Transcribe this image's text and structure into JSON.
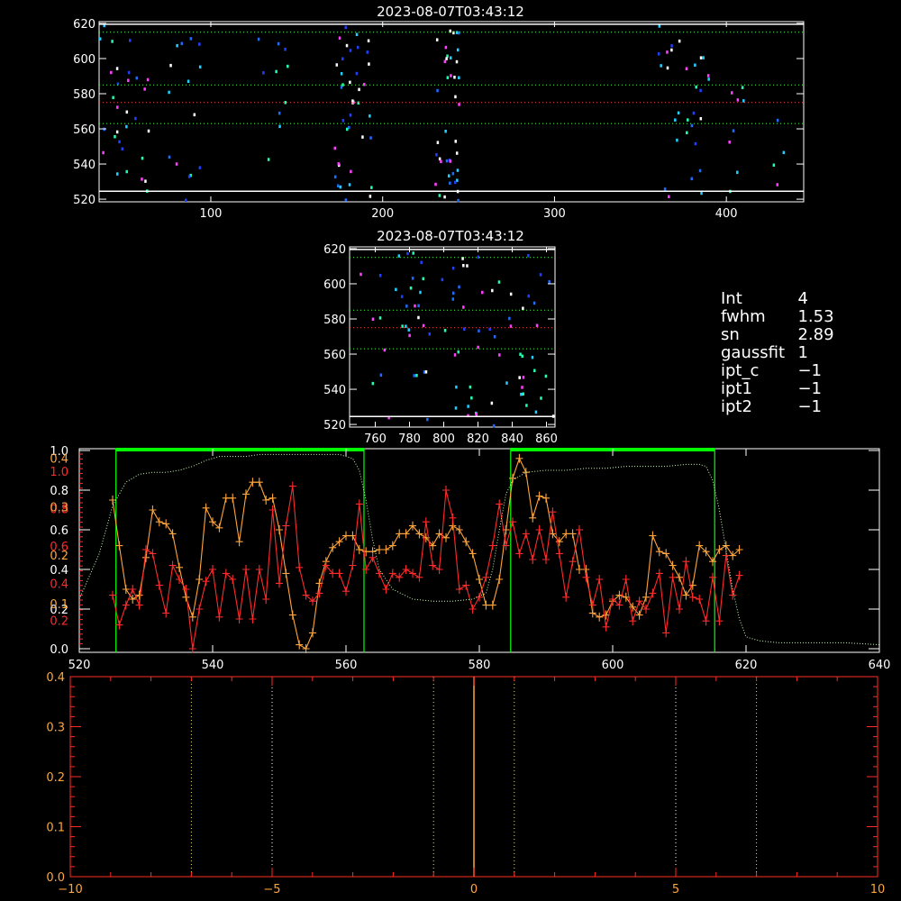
{
  "colors": {
    "bg": "#000000",
    "axis": "#ffffff",
    "orange": "#ffa53a",
    "red": "#ff2a2a",
    "green": "#00ff00",
    "lightgreen": "#c8ffb0",
    "speckle_blue": "#1e6bff",
    "speckle_cyan": "#20d0ff",
    "speckle_teal": "#20ffb0",
    "speckle_magenta": "#ff40ff",
    "dotted_green": "#40ff40",
    "dotted_red": "#ff4040"
  },
  "top_image": {
    "title": "2023-08-07T03:43:12",
    "xticks": [
      "100",
      "200",
      "300",
      "400"
    ],
    "yticks": [
      "520",
      "540",
      "560",
      "580",
      "600",
      "620"
    ]
  },
  "mid_image": {
    "title": "2023-08-07T03:43:12",
    "xticks": [
      "760",
      "780",
      "800",
      "820",
      "840",
      "860"
    ],
    "yticks": [
      "520",
      "540",
      "560",
      "580",
      "600",
      "620"
    ]
  },
  "info": [
    {
      "key": "Int",
      "value": "4"
    },
    {
      "key": "fwhm",
      "value": "1.53"
    },
    {
      "key": "sn",
      "value": "2.89"
    },
    {
      "key": "gaussfit",
      "value": "1"
    },
    {
      "key": "ipt_c",
      "value": "−1"
    },
    {
      "key": "ipt1",
      "value": "−1"
    },
    {
      "key": "ipt2",
      "value": "−1"
    }
  ],
  "chart_data": [
    {
      "type": "line",
      "xlim": [
        520,
        640
      ],
      "xticks": [
        "520",
        "540",
        "560",
        "580",
        "600",
        "620",
        "640"
      ],
      "left_ticks_white": [
        "0.0",
        "0.2",
        "0.4",
        "0.6",
        "0.8",
        "1.0"
      ],
      "left_ticks_red": [
        "0.2",
        "0.4",
        "0.6",
        "0.8",
        "1.0"
      ],
      "left_ticks_yellow": [
        "0.1",
        "0.2",
        "0.3",
        "0.4"
      ],
      "green_boxes": [
        [
          525.5,
          562.7
        ],
        [
          584.7,
          615.3
        ]
      ],
      "series": [
        {
          "color": "orange",
          "x": [
            525,
            526,
            527,
            528,
            529,
            530,
            531,
            532,
            533,
            534,
            535,
            536,
            537,
            538,
            539,
            540,
            541,
            542,
            543,
            544,
            545,
            546,
            547,
            548,
            549,
            550,
            551,
            552,
            553,
            554,
            555,
            556,
            557,
            558,
            559,
            560,
            561,
            562,
            563,
            564,
            565,
            566,
            567,
            568,
            569,
            570,
            571,
            572,
            573,
            574,
            575,
            576,
            577,
            578,
            579,
            580,
            581,
            582,
            583,
            584,
            585,
            586,
            587,
            588,
            589,
            590,
            591,
            592,
            593,
            594,
            595,
            596,
            597,
            598,
            599,
            600,
            601,
            602,
            603,
            604,
            605,
            606,
            607,
            608,
            609,
            610,
            611,
            612,
            613,
            614,
            615,
            616,
            617,
            618,
            619
          ],
          "y": [
            0.75,
            0.52,
            0.3,
            0.25,
            0.27,
            0.46,
            0.7,
            0.64,
            0.63,
            0.58,
            0.41,
            0.26,
            0.16,
            0.35,
            0.71,
            0.64,
            0.61,
            0.76,
            0.76,
            0.54,
            0.78,
            0.84,
            0.84,
            0.75,
            0.76,
            0.6,
            0.38,
            0.17,
            0.02,
            0.0,
            0.08,
            0.33,
            0.44,
            0.51,
            0.54,
            0.57,
            0.57,
            0.5,
            0.49,
            0.49,
            0.5,
            0.5,
            0.52,
            0.58,
            0.58,
            0.62,
            0.58,
            0.56,
            0.52,
            0.58,
            0.56,
            0.62,
            0.6,
            0.54,
            0.48,
            0.35,
            0.22,
            0.22,
            0.35,
            0.6,
            0.86,
            0.96,
            0.89,
            0.66,
            0.77,
            0.76,
            0.58,
            0.54,
            0.58,
            0.58,
            0.4,
            0.4,
            0.18,
            0.16,
            0.17,
            0.24,
            0.27,
            0.26,
            0.21,
            0.17,
            0.26,
            0.57,
            0.49,
            0.48,
            0.42,
            0.36,
            0.27,
            0.32,
            0.52,
            0.49,
            0.44,
            0.5,
            0.52,
            0.47,
            0.5
          ]
        },
        {
          "color": "red",
          "x": [
            525,
            526,
            527,
            528,
            529,
            530,
            531,
            532,
            533,
            534,
            535,
            536,
            537,
            538,
            539,
            540,
            541,
            542,
            543,
            544,
            545,
            546,
            547,
            548,
            549,
            550,
            551,
            552,
            553,
            554,
            555,
            556,
            557,
            558,
            559,
            560,
            561,
            562,
            563,
            564,
            565,
            566,
            567,
            568,
            569,
            570,
            571,
            572,
            573,
            574,
            575,
            576,
            577,
            578,
            579,
            580,
            581,
            582,
            583,
            584,
            585,
            586,
            587,
            588,
            589,
            590,
            591,
            592,
            593,
            594,
            595,
            596,
            597,
            598,
            599,
            600,
            601,
            602,
            603,
            604,
            605,
            606,
            607,
            608,
            609,
            610,
            611,
            612,
            613,
            614,
            615,
            616,
            617,
            618,
            619
          ],
          "y": [
            0.27,
            0.12,
            0.22,
            0.3,
            0.22,
            0.5,
            0.48,
            0.32,
            0.18,
            0.42,
            0.35,
            0.3,
            0.0,
            0.2,
            0.34,
            0.4,
            0.16,
            0.38,
            0.35,
            0.15,
            0.4,
            0.15,
            0.4,
            0.25,
            0.7,
            0.33,
            0.62,
            0.82,
            0.41,
            0.27,
            0.24,
            0.28,
            0.42,
            0.38,
            0.38,
            0.29,
            0.42,
            0.73,
            0.4,
            0.46,
            0.38,
            0.3,
            0.38,
            0.36,
            0.4,
            0.38,
            0.36,
            0.64,
            0.42,
            0.4,
            0.8,
            0.66,
            0.3,
            0.32,
            0.2,
            0.26,
            0.36,
            0.52,
            0.73,
            0.52,
            0.64,
            0.48,
            0.58,
            0.45,
            0.6,
            0.45,
            0.69,
            0.48,
            0.26,
            0.44,
            0.6,
            0.36,
            0.22,
            0.35,
            0.11,
            0.25,
            0.22,
            0.35,
            0.14,
            0.24,
            0.2,
            0.28,
            0.38,
            0.08,
            0.36,
            0.2,
            0.44,
            0.26,
            0.25,
            0.14,
            0.36,
            0.14,
            0.47,
            0.27,
            0.37
          ]
        },
        {
          "color": "lightgreen",
          "style": "dotted",
          "x": [
            520,
            523,
            525,
            527,
            529,
            531,
            533,
            535,
            537,
            539,
            541,
            543,
            545,
            547,
            549,
            551,
            553,
            555,
            557,
            559,
            561,
            562,
            563,
            564,
            565,
            567,
            570,
            573,
            576,
            579,
            581,
            582,
            583,
            584,
            585,
            587,
            590,
            593,
            596,
            599,
            602,
            605,
            608,
            611,
            613,
            614,
            615,
            616,
            617,
            618,
            619,
            620,
            622,
            625,
            630,
            635,
            640
          ],
          "y": [
            0.25,
            0.48,
            0.72,
            0.84,
            0.88,
            0.89,
            0.89,
            0.9,
            0.92,
            0.95,
            0.97,
            0.97,
            0.97,
            0.98,
            0.98,
            0.98,
            0.98,
            0.98,
            0.98,
            0.98,
            0.96,
            0.9,
            0.75,
            0.55,
            0.4,
            0.3,
            0.25,
            0.24,
            0.24,
            0.25,
            0.28,
            0.4,
            0.6,
            0.78,
            0.85,
            0.89,
            0.9,
            0.9,
            0.91,
            0.91,
            0.92,
            0.92,
            0.92,
            0.93,
            0.93,
            0.92,
            0.85,
            0.7,
            0.5,
            0.3,
            0.15,
            0.06,
            0.04,
            0.03,
            0.03,
            0.03,
            0.02
          ]
        }
      ]
    },
    {
      "type": "line",
      "xlim": [
        -10,
        10
      ],
      "ylim": [
        0.0,
        0.4
      ],
      "xticks": [
        "−10",
        "−5",
        "0",
        "5",
        "10"
      ],
      "yticks": [
        "0.0",
        "0.1",
        "0.2",
        "0.3",
        "0.4"
      ],
      "yellow_dotted_lines": [
        -7,
        -1,
        1,
        7
      ],
      "white_dotted_lines": [
        -5,
        5
      ],
      "center_line": 0
    }
  ]
}
